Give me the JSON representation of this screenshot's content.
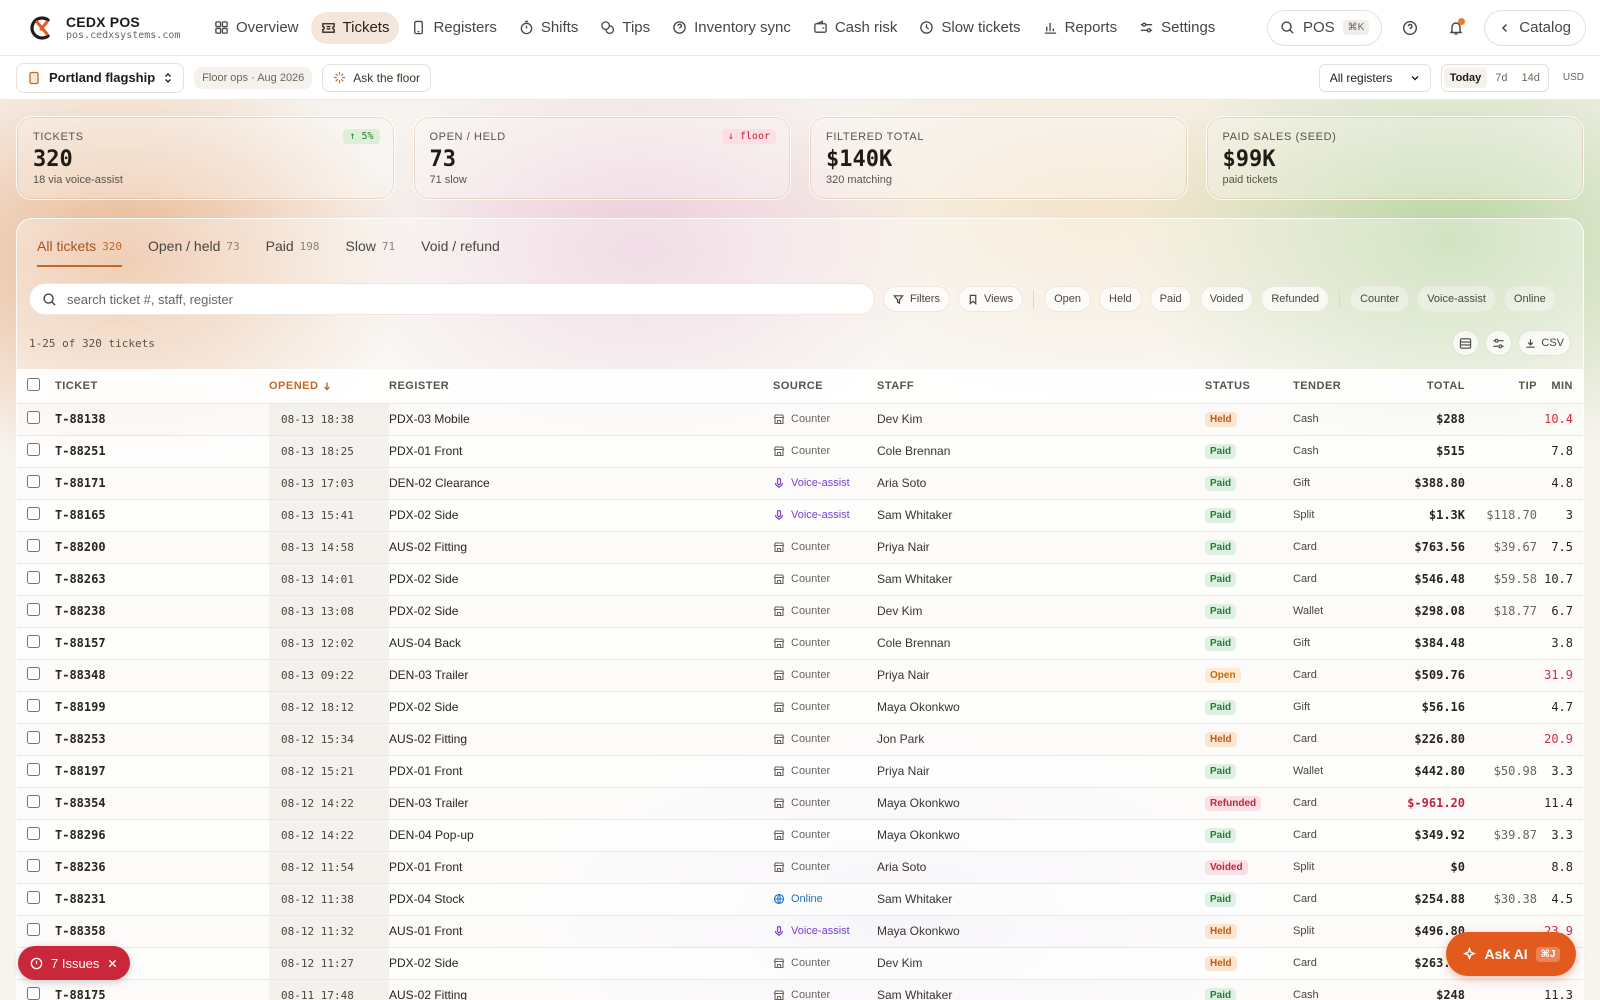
{
  "brand": {
    "name": "CEDX POS",
    "url": "pos.cedxsystems.com"
  },
  "nav": [
    {
      "label": "Overview",
      "icon": "grid-icon",
      "active": false
    },
    {
      "label": "Tickets",
      "icon": "ticket-icon",
      "active": true
    },
    {
      "label": "Registers",
      "icon": "tablet-icon",
      "active": false
    },
    {
      "label": "Shifts",
      "icon": "timer-icon",
      "active": false
    },
    {
      "label": "Tips",
      "icon": "coins-icon",
      "active": false
    },
    {
      "label": "Inventory sync",
      "icon": "help-circle-icon",
      "active": false
    },
    {
      "label": "Cash risk",
      "icon": "wallet-icon",
      "active": false
    },
    {
      "label": "Slow tickets",
      "icon": "clock-icon",
      "active": false
    },
    {
      "label": "Reports",
      "icon": "bar-chart-icon",
      "active": false
    },
    {
      "label": "Settings",
      "icon": "sliders-icon",
      "active": false
    }
  ],
  "top_right": {
    "search_label": "POS",
    "search_kbd": "⌘K",
    "catalog_label": "Catalog"
  },
  "subbar": {
    "location": "Portland flagship",
    "floor_chip": "Floor ops · Aug 2026",
    "ask_floor": "Ask the floor",
    "register_select": "All registers",
    "ranges": [
      "Today",
      "7d",
      "14d"
    ],
    "active_range": "Today",
    "currency": "USD"
  },
  "kpis": [
    {
      "label": "TICKETS",
      "value": "320",
      "sub": "18 via voice-assist",
      "badge": "↑ 5%",
      "badge_kind": "up"
    },
    {
      "label": "OPEN / HELD",
      "value": "73",
      "sub": "71 slow",
      "badge": "↓ floor",
      "badge_kind": "down"
    },
    {
      "label": "FILTERED TOTAL",
      "value": "$140K",
      "sub": "320 matching",
      "badge": "",
      "badge_kind": ""
    },
    {
      "label": "PAID SALES (SEED)",
      "value": "$99K",
      "sub": "paid tickets",
      "badge": "",
      "badge_kind": ""
    }
  ],
  "tabs": [
    {
      "label": "All tickets",
      "count": "320",
      "active": true
    },
    {
      "label": "Open / held",
      "count": "73",
      "active": false
    },
    {
      "label": "Paid",
      "count": "198",
      "active": false
    },
    {
      "label": "Slow",
      "count": "71",
      "active": false
    },
    {
      "label": "Void / refund",
      "count": "",
      "active": false
    }
  ],
  "search": {
    "placeholder": "search ticket #, staff, register"
  },
  "filters": {
    "filters_label": "Filters",
    "views_label": "Views"
  },
  "status_chips": [
    "Open",
    "Held",
    "Paid",
    "Voided",
    "Refunded"
  ],
  "source_chips": [
    "Counter",
    "Voice-assist",
    "Online"
  ],
  "meta": {
    "range_text": "1-25 of 320 tickets",
    "csv_label": "CSV"
  },
  "columns": {
    "ticket": "TICKET",
    "opened": "OPENED",
    "register": "REGISTER",
    "source": "SOURCE",
    "staff": "STAFF",
    "status": "STATUS",
    "tender": "TENDER",
    "total": "TOTAL",
    "tip": "TIP",
    "min": "MIN"
  },
  "rows": [
    {
      "ticket": "T-88138",
      "opened": "08-13 18:38",
      "register": "PDX-03 Mobile",
      "source": "Counter",
      "staff": "Dev Kim",
      "status": "Held",
      "tender": "Cash",
      "total": "$288",
      "tip": "",
      "min": "10.4",
      "slow": true
    },
    {
      "ticket": "T-88251",
      "opened": "08-13 18:25",
      "register": "PDX-01 Front",
      "source": "Counter",
      "staff": "Cole Brennan",
      "status": "Paid",
      "tender": "Cash",
      "total": "$515",
      "tip": "",
      "min": "7.8",
      "slow": false
    },
    {
      "ticket": "T-88171",
      "opened": "08-13 17:03",
      "register": "DEN-02 Clearance",
      "source": "Voice-assist",
      "staff": "Aria Soto",
      "status": "Paid",
      "tender": "Gift",
      "total": "$388.80",
      "tip": "",
      "min": "4.8",
      "slow": false
    },
    {
      "ticket": "T-88165",
      "opened": "08-13 15:41",
      "register": "PDX-02 Side",
      "source": "Voice-assist",
      "staff": "Sam Whitaker",
      "status": "Paid",
      "tender": "Split",
      "total": "$1.3K",
      "tip": "$118.70",
      "min": "3",
      "slow": false
    },
    {
      "ticket": "T-88200",
      "opened": "08-13 14:58",
      "register": "AUS-02 Fitting",
      "source": "Counter",
      "staff": "Priya Nair",
      "status": "Paid",
      "tender": "Card",
      "total": "$763.56",
      "tip": "$39.67",
      "min": "7.5",
      "slow": false
    },
    {
      "ticket": "T-88263",
      "opened": "08-13 14:01",
      "register": "PDX-02 Side",
      "source": "Counter",
      "staff": "Sam Whitaker",
      "status": "Paid",
      "tender": "Card",
      "total": "$546.48",
      "tip": "$59.58",
      "min": "10.7",
      "slow": false
    },
    {
      "ticket": "T-88238",
      "opened": "08-13 13:08",
      "register": "PDX-02 Side",
      "source": "Counter",
      "staff": "Dev Kim",
      "status": "Paid",
      "tender": "Wallet",
      "total": "$298.08",
      "tip": "$18.77",
      "min": "6.7",
      "slow": false
    },
    {
      "ticket": "T-88157",
      "opened": "08-13 12:02",
      "register": "AUS-04 Back",
      "source": "Counter",
      "staff": "Cole Brennan",
      "status": "Paid",
      "tender": "Gift",
      "total": "$384.48",
      "tip": "",
      "min": "3.8",
      "slow": false
    },
    {
      "ticket": "T-88348",
      "opened": "08-13 09:22",
      "register": "DEN-03 Trailer",
      "source": "Counter",
      "staff": "Priya Nair",
      "status": "Open",
      "tender": "Card",
      "total": "$509.76",
      "tip": "",
      "min": "31.9",
      "slow": true
    },
    {
      "ticket": "T-88199",
      "opened": "08-12 18:12",
      "register": "PDX-02 Side",
      "source": "Counter",
      "staff": "Maya Okonkwo",
      "status": "Paid",
      "tender": "Gift",
      "total": "$56.16",
      "tip": "",
      "min": "4.7",
      "slow": false
    },
    {
      "ticket": "T-88253",
      "opened": "08-12 15:34",
      "register": "AUS-02 Fitting",
      "source": "Counter",
      "staff": "Jon Park",
      "status": "Held",
      "tender": "Card",
      "total": "$226.80",
      "tip": "",
      "min": "20.9",
      "slow": true
    },
    {
      "ticket": "T-88197",
      "opened": "08-12 15:21",
      "register": "PDX-01 Front",
      "source": "Counter",
      "staff": "Priya Nair",
      "status": "Paid",
      "tender": "Wallet",
      "total": "$442.80",
      "tip": "$50.98",
      "min": "3.3",
      "slow": false
    },
    {
      "ticket": "T-88354",
      "opened": "08-12 14:22",
      "register": "DEN-03 Trailer",
      "source": "Counter",
      "staff": "Maya Okonkwo",
      "status": "Refunded",
      "tender": "Card",
      "total": "$-961.20",
      "tip": "",
      "min": "11.4",
      "slow": false
    },
    {
      "ticket": "T-88296",
      "opened": "08-12 14:22",
      "register": "DEN-04 Pop-up",
      "source": "Counter",
      "staff": "Maya Okonkwo",
      "status": "Paid",
      "tender": "Card",
      "total": "$349.92",
      "tip": "$39.87",
      "min": "3.3",
      "slow": false
    },
    {
      "ticket": "T-88236",
      "opened": "08-12 11:54",
      "register": "PDX-01 Front",
      "source": "Counter",
      "staff": "Aria Soto",
      "status": "Voided",
      "tender": "Split",
      "total": "$0",
      "tip": "",
      "min": "8.8",
      "slow": false
    },
    {
      "ticket": "T-88231",
      "opened": "08-12 11:38",
      "register": "PDX-04 Stock",
      "source": "Online",
      "staff": "Sam Whitaker",
      "status": "Paid",
      "tender": "Card",
      "total": "$254.88",
      "tip": "$30.38",
      "min": "4.5",
      "slow": false
    },
    {
      "ticket": "T-88358",
      "opened": "08-12 11:32",
      "register": "AUS-01 Front",
      "source": "Voice-assist",
      "staff": "Maya Okonkwo",
      "status": "Held",
      "tender": "Split",
      "total": "$496.80",
      "tip": "",
      "min": "23.9",
      "slow": true
    },
    {
      "ticket": "",
      "opened": "08-12 11:27",
      "register": "PDX-02 Side",
      "source": "Counter",
      "staff": "Dev Kim",
      "status": "Held",
      "tender": "Card",
      "total": "$263.52",
      "tip": "",
      "min": "",
      "slow": false
    },
    {
      "ticket": "T-88175",
      "opened": "08-11 17:48",
      "register": "AUS-02 Fitting",
      "source": "Counter",
      "staff": "Sam Whitaker",
      "status": "Paid",
      "tender": "Cash",
      "total": "$248",
      "tip": "",
      "min": "11.3",
      "slow": false
    }
  ],
  "issues": {
    "label": "7 Issues"
  },
  "ask_ai": {
    "label": "Ask AI",
    "kbd": "⌘J"
  },
  "colors": {
    "accent": "#c0692d",
    "danger": "#c8283a",
    "ai": "#e35a1f"
  }
}
